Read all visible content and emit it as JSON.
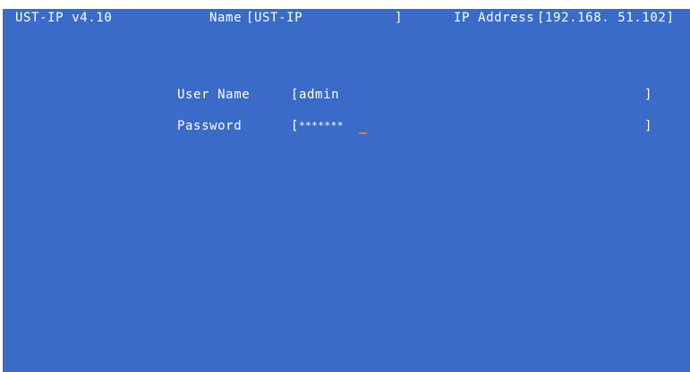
{
  "header": {
    "product_version": "UST-IP v4.10",
    "name_label": "Name",
    "name_open_bracket": "[",
    "name_value": "UST-IP",
    "name_close_bracket": "]",
    "ip_label": "IP Address",
    "ip_value": "[192.168. 51.102]"
  },
  "login": {
    "username_label": "User Name",
    "username_open_bracket": "[",
    "username_value": "admin",
    "username_close_bracket": "]",
    "password_label": "Password",
    "password_open_bracket": "[",
    "password_value": "*******",
    "password_close_bracket": "]"
  },
  "colors": {
    "background": "#3a6bc8",
    "text": "#ffffff",
    "cursor": "#e07a2a"
  }
}
